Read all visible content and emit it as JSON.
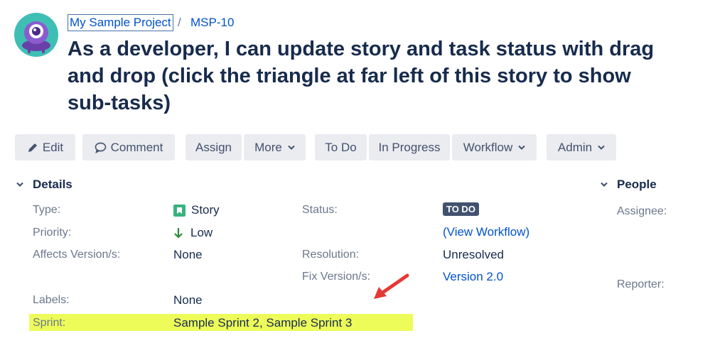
{
  "breadcrumb": {
    "project": "My Sample Project",
    "separator": "/",
    "issue_key": "MSP-10"
  },
  "issue": {
    "title": "As a developer, I can update story and task status with drag and drop (click the triangle at far left of this story to show sub-tasks)"
  },
  "toolbar": {
    "edit": "Edit",
    "comment": "Comment",
    "assign": "Assign",
    "more": "More",
    "todo": "To Do",
    "in_progress": "In Progress",
    "workflow": "Workflow",
    "admin": "Admin"
  },
  "details": {
    "heading": "Details",
    "type_label": "Type:",
    "type_value": "Story",
    "priority_label": "Priority:",
    "priority_value": "Low",
    "affects_label": "Affects Version/s:",
    "affects_value": "None",
    "labels_label": "Labels:",
    "labels_value": "None",
    "sprint_label": "Sprint:",
    "sprint_value": "Sample Sprint 2, Sample Sprint 3",
    "status_label": "Status:",
    "status_value": "TO DO",
    "view_workflow": "(View Workflow)",
    "resolution_label": "Resolution:",
    "resolution_value": "Unresolved",
    "fix_label": "Fix Version/s:",
    "fix_value": "Version 2.0"
  },
  "people": {
    "heading": "People",
    "assignee_label": "Assignee:",
    "reporter_label": "Reporter:"
  },
  "icons": {
    "avatar": "project-avatar-icon",
    "edit": "pencil-icon",
    "comment": "comment-icon",
    "story": "story-icon",
    "priority": "arrow-down-icon",
    "toggle": "chevron-down-icon",
    "annotation": "red-arrow-annotation"
  },
  "colors": {
    "link": "#0052cc",
    "button_bg": "#ebecf0",
    "lozenge_bg": "#42526e",
    "story_green": "#36b37e",
    "priority_green": "#2a8a3a",
    "highlight": "#eefc5a",
    "annotation_red": "#e53935",
    "avatar_teal": "#3fbfb4",
    "avatar_purple": "#7e4fbf"
  }
}
